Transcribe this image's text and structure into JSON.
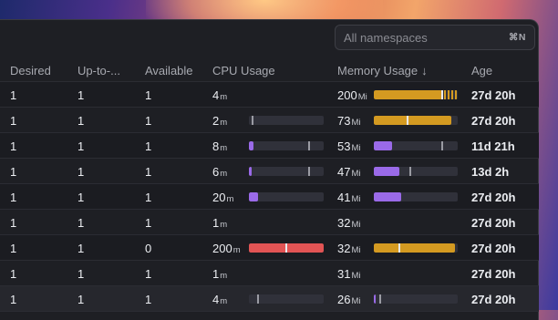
{
  "namespace_select": {
    "placeholder": "All namespaces",
    "shortcut": "⌘N"
  },
  "columns": {
    "desired": "Desired",
    "up_to_date": "Up-to-...",
    "available": "Available",
    "cpu_usage": "CPU Usage",
    "memory_usage": "Memory Usage",
    "sort_arrow": "↓",
    "age": "Age"
  },
  "rows": [
    {
      "desired": "1",
      "up_to_date": "1",
      "available": "1",
      "cpu_value": "4",
      "cpu_unit": "m",
      "mem_value": "200",
      "mem_unit": "Mi",
      "age": "27d 20h"
    },
    {
      "desired": "1",
      "up_to_date": "1",
      "available": "1",
      "cpu_value": "2",
      "cpu_unit": "m",
      "mem_value": "73",
      "mem_unit": "Mi",
      "age": "27d 20h"
    },
    {
      "desired": "1",
      "up_to_date": "1",
      "available": "1",
      "cpu_value": "8",
      "cpu_unit": "m",
      "mem_value": "53",
      "mem_unit": "Mi",
      "age": "11d 21h"
    },
    {
      "desired": "1",
      "up_to_date": "1",
      "available": "1",
      "cpu_value": "6",
      "cpu_unit": "m",
      "mem_value": "47",
      "mem_unit": "Mi",
      "age": "13d 2h"
    },
    {
      "desired": "1",
      "up_to_date": "1",
      "available": "1",
      "cpu_value": "20",
      "cpu_unit": "m",
      "mem_value": "41",
      "mem_unit": "Mi",
      "age": "27d 20h"
    },
    {
      "desired": "1",
      "up_to_date": "1",
      "available": "1",
      "cpu_value": "1",
      "cpu_unit": "m",
      "mem_value": "32",
      "mem_unit": "Mi",
      "age": "27d 20h"
    },
    {
      "desired": "1",
      "up_to_date": "1",
      "available": "0",
      "cpu_value": "200",
      "cpu_unit": "m",
      "mem_value": "32",
      "mem_unit": "Mi",
      "age": "27d 20h"
    },
    {
      "desired": "1",
      "up_to_date": "1",
      "available": "1",
      "cpu_value": "1",
      "cpu_unit": "m",
      "mem_value": "31",
      "mem_unit": "Mi",
      "age": "27d 20h"
    },
    {
      "desired": "1",
      "up_to_date": "1",
      "available": "1",
      "cpu_value": "4",
      "cpu_unit": "m",
      "mem_value": "26",
      "mem_unit": "Mi",
      "age": "27d 20h"
    }
  ],
  "usage_bars": [
    {
      "cpu": null,
      "mem": {
        "fill": 0.82,
        "color": "#d49a21",
        "limit": 0.82,
        "overflow": true
      }
    },
    {
      "cpu": {
        "fill": 0.0,
        "color": "#9a6ae8",
        "limit": 0.05
      },
      "mem": {
        "fill": 0.92,
        "color": "#d49a21",
        "limit": 0.4
      }
    },
    {
      "cpu": {
        "fill": 0.06,
        "color": "#9a6ae8",
        "limit": 0.8
      },
      "mem": {
        "fill": 0.22,
        "color": "#9a6ae8",
        "limit": 0.81
      }
    },
    {
      "cpu": {
        "fill": 0.04,
        "color": "#9a6ae8",
        "limit": 0.8
      },
      "mem": {
        "fill": 0.3,
        "color": "#9a6ae8",
        "limit": 0.43
      }
    },
    {
      "cpu": {
        "fill": 0.12,
        "color": "#9a6ae8",
        "limit": null
      },
      "mem": {
        "fill": 0.33,
        "color": "#9a6ae8",
        "limit": null
      }
    },
    {
      "cpu": null,
      "mem": null
    },
    {
      "cpu": {
        "fill": 1.0,
        "color": "#e25454",
        "limit": 0.5
      },
      "mem": {
        "fill": 0.97,
        "color": "#d49a21",
        "limit": 0.3
      }
    },
    {
      "cpu": null,
      "mem": null
    },
    {
      "cpu": {
        "fill": 0.0,
        "color": "#9a6ae8",
        "limit": 0.12
      },
      "mem": {
        "fill": 0.02,
        "color": "#9a6ae8",
        "limit": 0.08
      }
    }
  ]
}
